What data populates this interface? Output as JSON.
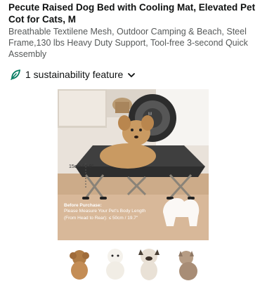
{
  "product": {
    "title": "Pecute Raised Dog Bed with Cooling Mat, Elevated Pet Cot for Cats, M",
    "subtitle": "Breathable Textilene Mesh, Outdoor Camping & Beach, Steel Frame,130 lbs Heavy Duty Support, Tool-free 3-second Quick Assembly"
  },
  "sustainability": {
    "label": "1 sustainability feature",
    "icon": "leaf-icon",
    "expand_icon": "chevron-down-icon",
    "accent": "#067d62"
  },
  "image": {
    "height_label": "15cm / 5.9\"",
    "before_purchase": "Before Purchase:",
    "measure_text": "Please Measure Your Pet's Body Length",
    "from_head_text": "(From Head to Rear): ≤ 50cm / 19.7\""
  }
}
